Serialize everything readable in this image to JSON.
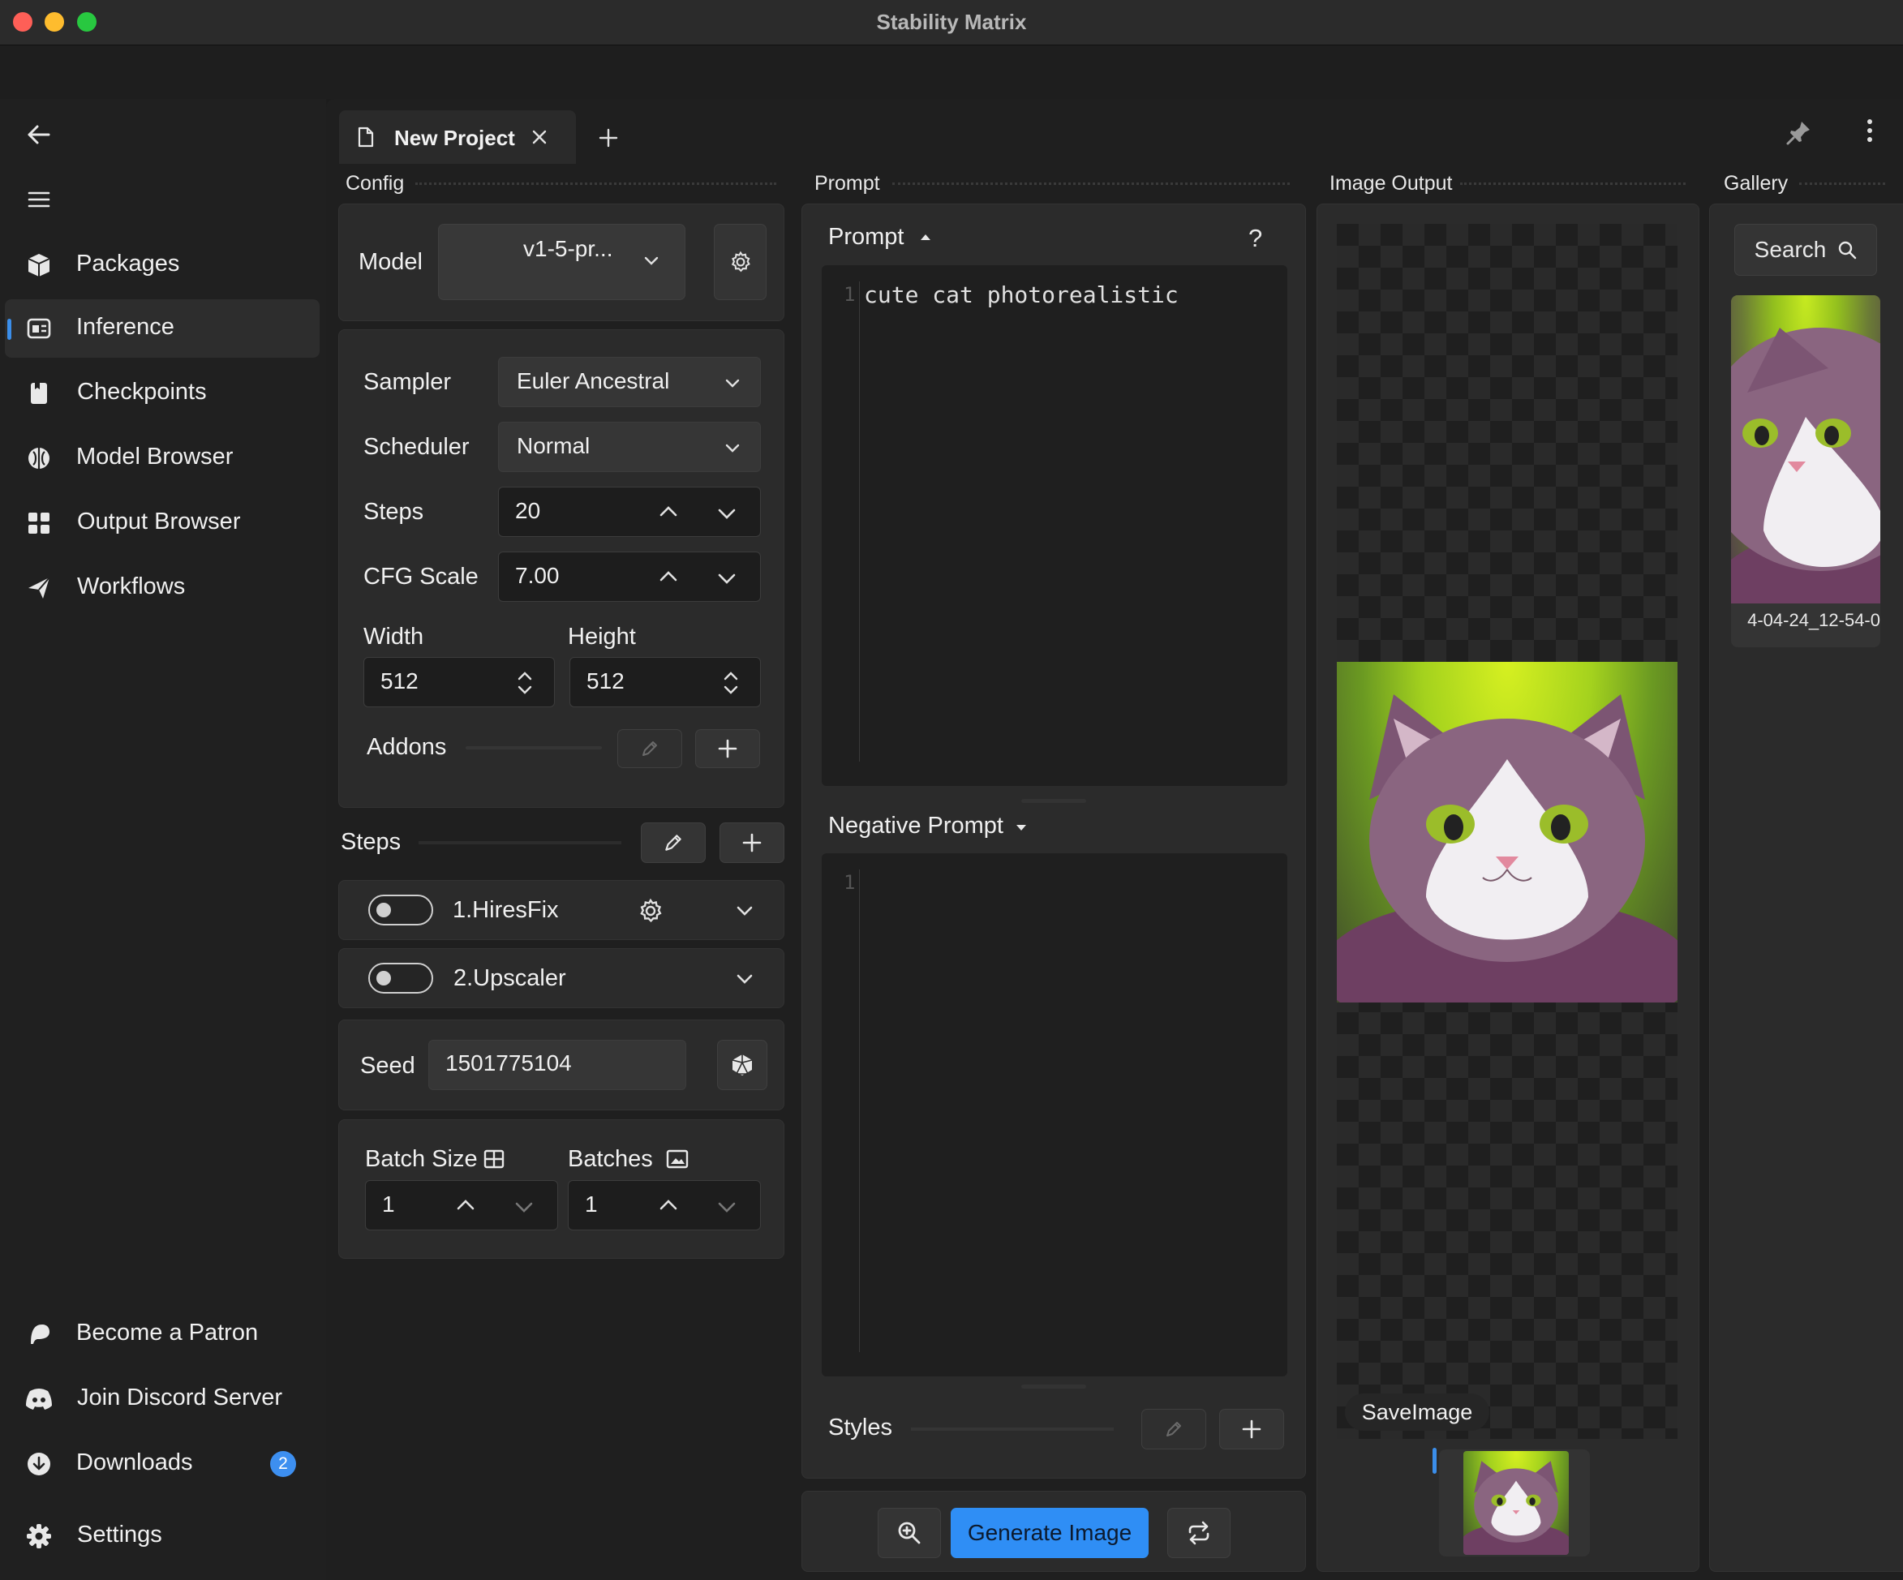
{
  "window": {
    "title": "Stability Matrix"
  },
  "sidebar": {
    "items": [
      {
        "label": "Packages",
        "icon": "package-icon"
      },
      {
        "label": "Inference",
        "icon": "inference-icon",
        "active": true
      },
      {
        "label": "Checkpoints",
        "icon": "checkpoints-icon"
      },
      {
        "label": "Model Browser",
        "icon": "model-browser-icon"
      },
      {
        "label": "Output Browser",
        "icon": "output-browser-icon"
      },
      {
        "label": "Workflows",
        "icon": "workflows-icon"
      }
    ],
    "footer": [
      {
        "label": "Become a Patron",
        "icon": "patreon-icon"
      },
      {
        "label": "Join Discord Server",
        "icon": "discord-icon"
      },
      {
        "label": "Downloads",
        "icon": "download-icon",
        "badge": "2"
      },
      {
        "label": "Settings",
        "icon": "gear-icon"
      }
    ]
  },
  "tabs": [
    {
      "label": "New Project"
    }
  ],
  "config": {
    "header": "Config",
    "model_label": "Model",
    "model_value": "v1-5-pr...",
    "sampler_label": "Sampler",
    "sampler_value": "Euler Ancestral",
    "scheduler_label": "Scheduler",
    "scheduler_value": "Normal",
    "steps_label": "Steps",
    "steps_value": "20",
    "cfg_label": "CFG Scale",
    "cfg_value": "7.00",
    "width_label": "Width",
    "width_value": "512",
    "height_label": "Height",
    "height_value": "512",
    "addons_label": "Addons",
    "steps_section_label": "Steps",
    "step_items": [
      {
        "label": "1.HiresFix",
        "enabled": false
      },
      {
        "label": "2.Upscaler",
        "enabled": false
      }
    ],
    "seed_label": "Seed",
    "seed_value": "1501775104",
    "batch_size_label": "Batch Size",
    "batch_size_value": "1",
    "batches_label": "Batches",
    "batches_value": "1"
  },
  "prompt": {
    "header": "Prompt",
    "prompt_title": "Prompt",
    "help": "?",
    "prompt_line_no": "1",
    "prompt_text": "cute cat photorealistic",
    "negative_title": "Negative Prompt",
    "negative_line_no": "1",
    "negative_text": "",
    "styles_label": "Styles",
    "generate_label": "Generate Image"
  },
  "output": {
    "header": "Image Output",
    "node_label": "SaveImage"
  },
  "gallery": {
    "header": "Gallery",
    "search_label": "Search",
    "items": [
      {
        "caption": "4-04-24_12-54-0"
      }
    ]
  },
  "colors": {
    "accent": "#2f8ef5",
    "active_indicator": "#3b8eea",
    "badge": "#3d8ff0"
  }
}
